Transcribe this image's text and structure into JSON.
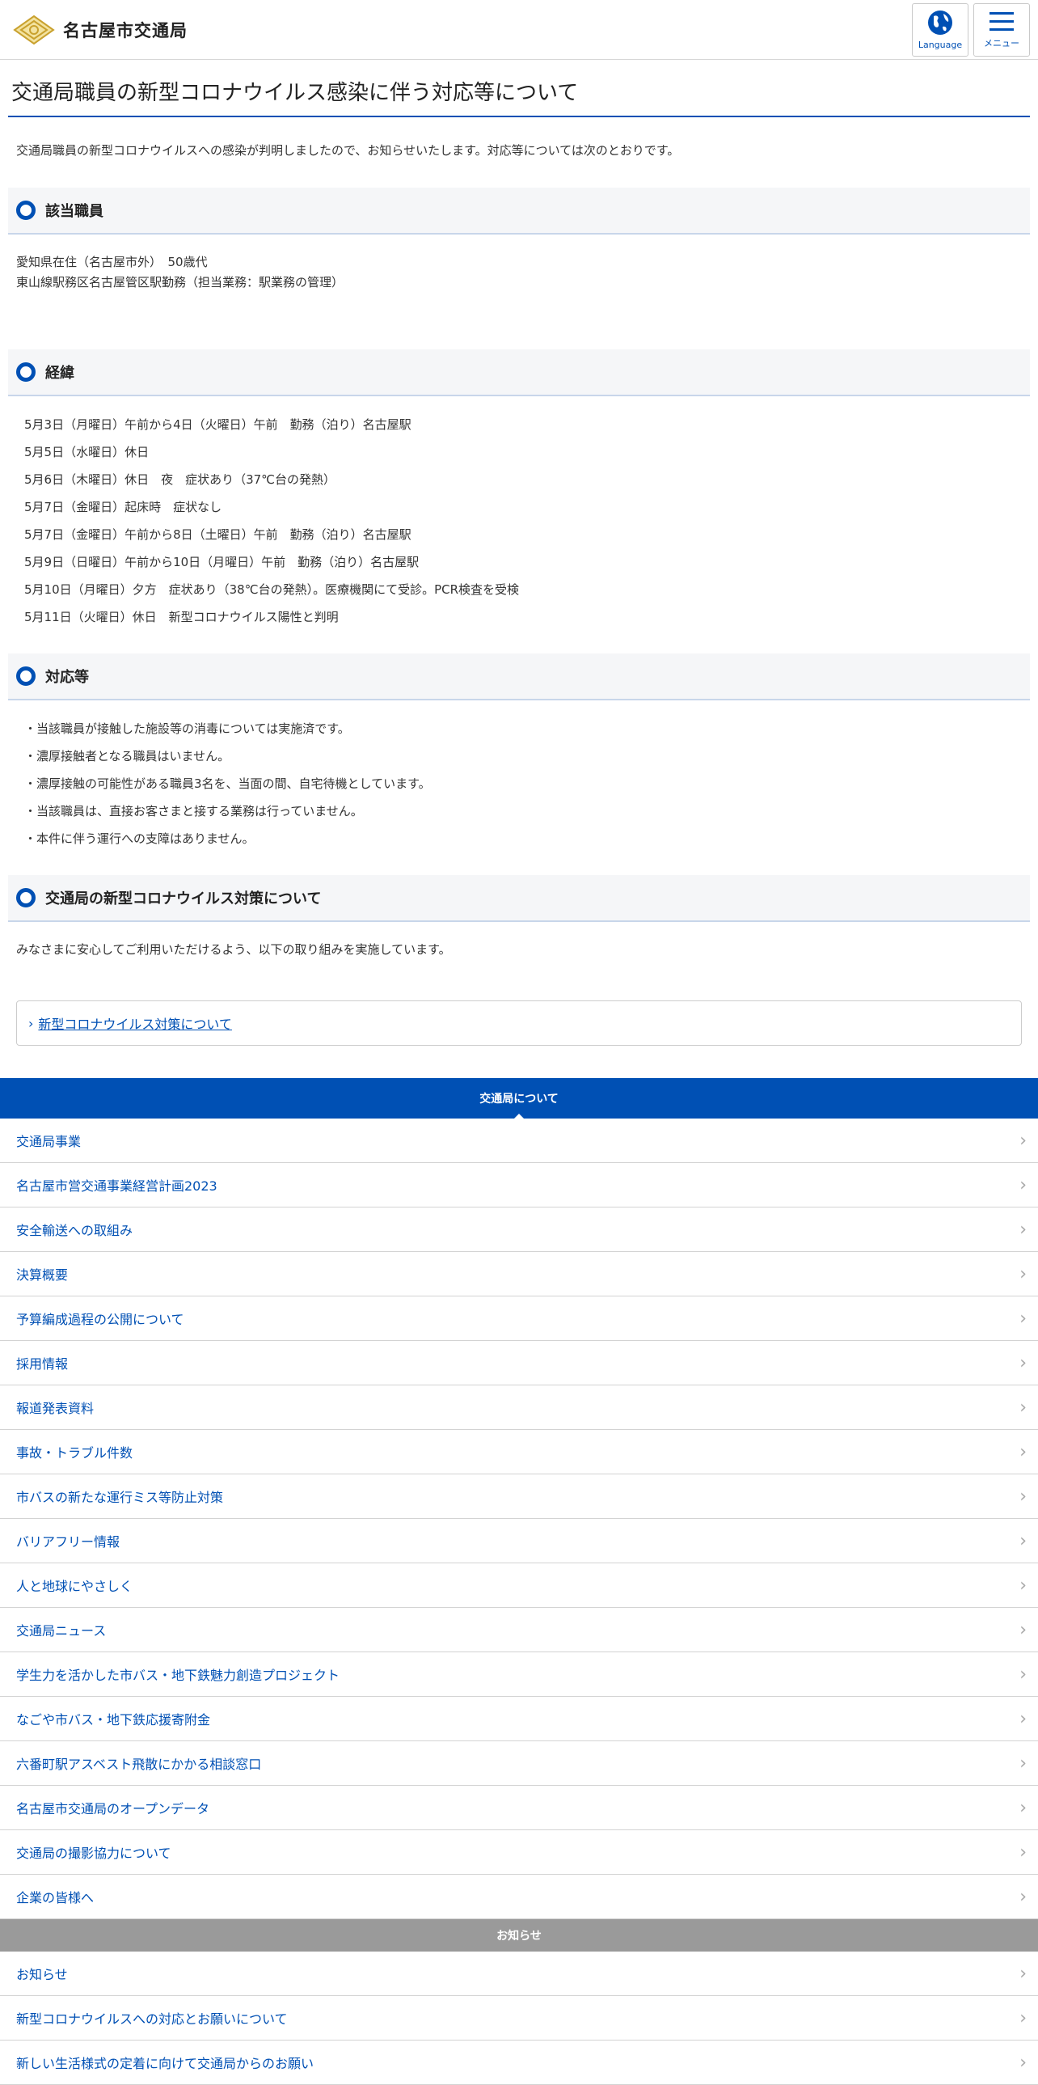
{
  "header": {
    "logo_text": "名古屋市交通局",
    "language_label": "Language",
    "menu_label": "メニュー"
  },
  "page_title": "交通局職員の新型コロナウイルス感染に伴う対応等について",
  "intro": "交通局職員の新型コロナウイルスへの感染が判明しましたので、お知らせいたします。対応等については次のとおりです。",
  "sections": {
    "staff": {
      "title": "該当職員",
      "lines": [
        "愛知県在住（名古屋市外）　50歳代",
        "東山線駅務区名古屋管区駅勤務（担当業務：駅業務の管理）"
      ]
    },
    "history": {
      "title": "経緯",
      "lines": [
        "5月3日（月曜日）午前から4日（火曜日）午前　勤務（泊り）名古屋駅",
        "5月5日（水曜日）休日",
        "5月6日（木曜日）休日　夜　症状あり（37℃台の発熱）",
        "5月7日（金曜日）起床時　症状なし",
        "5月7日（金曜日）午前から8日（土曜日）午前　勤務（泊り）名古屋駅",
        "5月9日（日曜日）午前から10日（月曜日）午前　勤務（泊り）名古屋駅",
        "5月10日（月曜日）夕方　症状あり（38℃台の発熱）。医療機関にて受診。PCR検査を受検",
        "5月11日（火曜日）休日　新型コロナウイルス陽性と判明"
      ]
    },
    "response": {
      "title": "対応等",
      "lines": [
        "・当該職員が接触した施設等の消毒については実施済です。",
        "・濃厚接触者となる職員はいません。",
        "・濃厚接触の可能性がある職員3名を、当面の間、自宅待機としています。",
        "・当該職員は、直接お客さまと接する業務は行っていません。",
        "・本件に伴う運行への支障はありません。"
      ]
    },
    "measures": {
      "title": "交通局の新型コロナウイルス対策について",
      "text": "みなさまに安心してご利用いただけるよう、以下の取り組みを実施しています。",
      "link": "新型コロナウイルス対策について"
    }
  },
  "footer_nav": {
    "about_title": "交通局について",
    "about_items": [
      "交通局事業",
      "名古屋市営交通事業経営計画2023",
      "安全輸送への取組み",
      "決算概要",
      "予算編成過程の公開について",
      "採用情報",
      "報道発表資料",
      "事故・トラブル件数",
      "市バスの新たな運行ミス等防止対策",
      "バリアフリー情報",
      "人と地球にやさしく",
      "交通局ニュース",
      "学生力を活かした市バス・地下鉄魅力創造プロジェクト",
      "なごや市バス・地下鉄応援寄附金",
      "六番町駅アスベスト飛散にかかる相談窓口",
      "名古屋市交通局のオープンデータ",
      "交通局の撮影協力について",
      "企業の皆様へ"
    ],
    "news_title": "お知らせ",
    "news_items": [
      "お知らせ",
      "新型コロナウイルスへの対応とお願いについて",
      "新しい生活様式の定着に向けて交通局からのお願い"
    ]
  }
}
